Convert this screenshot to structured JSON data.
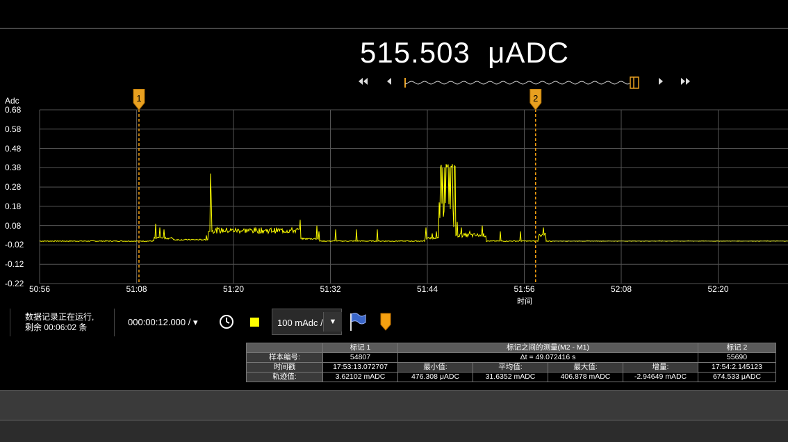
{
  "reading": {
    "value": "515.503",
    "unit": "μADC"
  },
  "nav": {
    "first": "⏮",
    "prev": "◀",
    "next": "▶",
    "last": "⏭"
  },
  "chart_data": {
    "type": "line",
    "ylabel": "Adc",
    "xlabel": "时间",
    "y_ticks": [
      "0.68",
      "0.58",
      "0.48",
      "0.38",
      "0.28",
      "0.18",
      "0.08",
      "-0.02",
      "-0.12",
      "-0.22"
    ],
    "y_tick_values": [
      0.68,
      0.58,
      0.48,
      0.38,
      0.28,
      0.18,
      0.08,
      -0.02,
      -0.12,
      -0.22
    ],
    "x_ticks": [
      "50:56",
      "51:08",
      "51:20",
      "51:32",
      "51:44",
      "51:56",
      "52:08",
      "52:20"
    ],
    "x_tick_seconds": [
      3056,
      3068,
      3080,
      3092,
      3104,
      3116,
      3128,
      3140
    ],
    "xlim_seconds": [
      3056,
      3098.3
    ],
    "ylim": [
      -0.22,
      0.68
    ],
    "grid": true,
    "series_color": "#ffff00",
    "markers": [
      {
        "label": "1",
        "x_seconds": 3068.3
      },
      {
        "label": "2",
        "x_seconds": 3117.4
      }
    ]
  },
  "controls": {
    "status_line1": "数据记录正在运行,",
    "status_line2": "剩余 00:06:02 条",
    "timebase": "000:00:12.000 / ▾",
    "scale": "100 mAdc /",
    "scale_dropdown": "▼"
  },
  "table": {
    "header": [
      "",
      "标记 1",
      "标记之间的测量(M2 - M1)",
      "标记 2"
    ],
    "row1": {
      "label": "样本编号:",
      "m1": "54807",
      "delta": "Δt = 49.072416 s",
      "m2": "55690"
    },
    "row2": {
      "label": "时间戳",
      "m1": "17:53:13.072707",
      "min_label": "最小值:",
      "avg_label": "平均值:",
      "max_label": "最大值:",
      "inc_label": "增量:",
      "m2": "17:54:2.145123"
    },
    "row3": {
      "label": "轨迹值:",
      "m1": "3.62102 mADC",
      "min": "476.308 μADC",
      "avg": "31.6352 mADC",
      "max": "406.878 mADC",
      "inc": "-2.94649 mADC",
      "m2": "674.533 μADC"
    }
  }
}
